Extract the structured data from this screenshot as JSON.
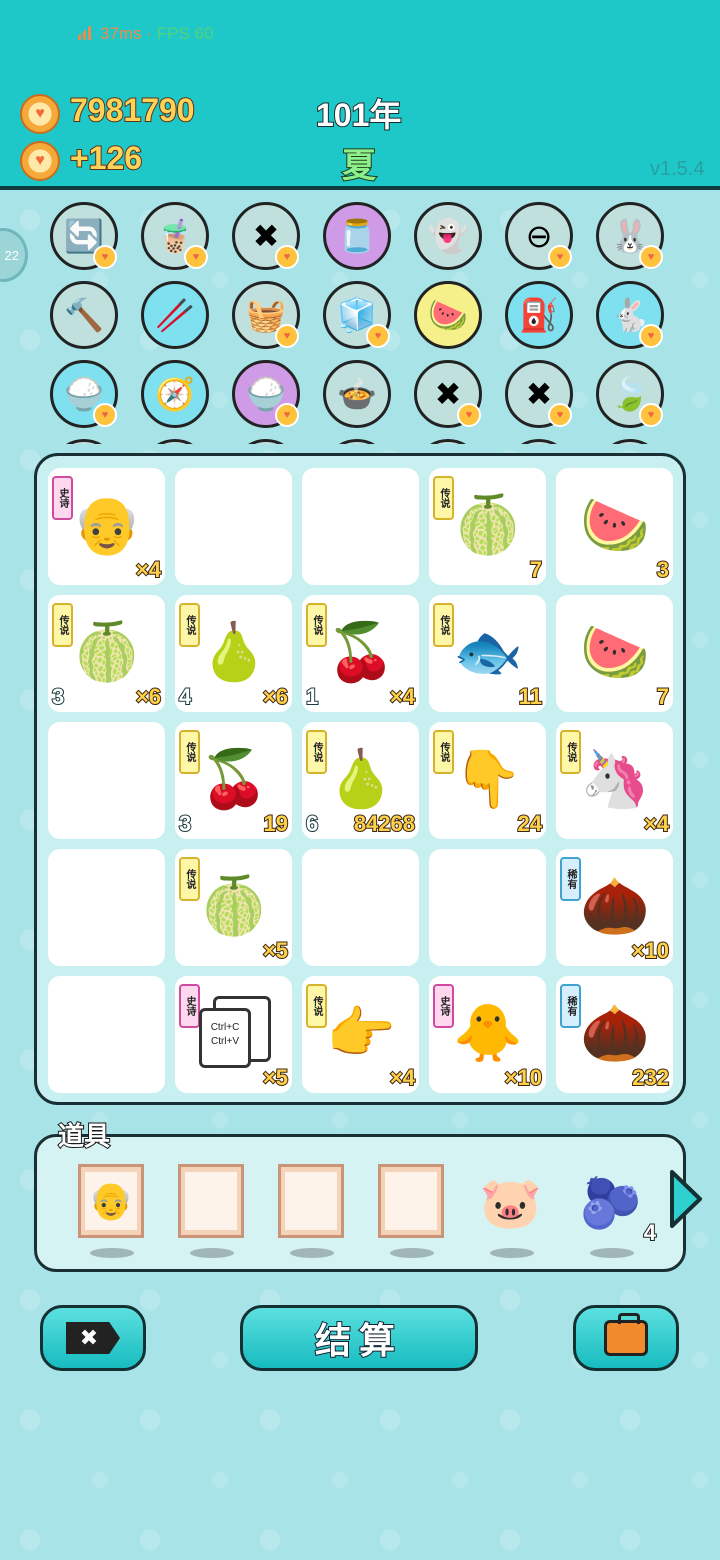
{
  "status": {
    "ping": "37ms",
    "sep": "·",
    "fps": "FPS 60"
  },
  "header": {
    "coins": "7981790",
    "income": "+126",
    "year": "101年",
    "season": "夏",
    "version": "v1.5.4"
  },
  "side_bubble": "22",
  "top_icons": [
    {
      "icon": "refresh-icon",
      "glyph": "🔄",
      "bg": "#bfe0dc",
      "badge": true
    },
    {
      "icon": "bubble-tea-icon",
      "glyph": "🧋",
      "bg": "#bfe0dc",
      "badge": true
    },
    {
      "icon": "delete-tag-icon",
      "glyph": "✖",
      "bg": "#bfe0dc",
      "badge": true
    },
    {
      "icon": "jar-icon",
      "glyph": "🫙",
      "bg": "#cf9be6",
      "badge": false
    },
    {
      "icon": "ghost-icon",
      "glyph": "👻",
      "bg": "#bfe0dc",
      "badge": false
    },
    {
      "icon": "no-entry-icon",
      "glyph": "⊖",
      "bg": "#bfe0dc",
      "badge": true
    },
    {
      "icon": "rabbit-icon",
      "glyph": "🐰",
      "bg": "#bfe0dc",
      "badge": true
    },
    {
      "icon": "hammer-icon",
      "glyph": "🔨",
      "bg": "#bfe0dc",
      "badge": false
    },
    {
      "icon": "chopsticks-icon",
      "glyph": "🥢",
      "bg": "#7fe0f0",
      "badge": false
    },
    {
      "icon": "fruit-basket-icon",
      "glyph": "🧺",
      "bg": "#bfe0dc",
      "badge": true
    },
    {
      "icon": "sugar-cubes-icon",
      "glyph": "🧊",
      "bg": "#bfe0dc",
      "badge": true
    },
    {
      "icon": "fruit-plate-icon",
      "glyph": "🍉",
      "bg": "#f6f08a",
      "badge": false
    },
    {
      "icon": "pump-icon",
      "glyph": "⛽",
      "bg": "#7fe0f0",
      "badge": false
    },
    {
      "icon": "rabbit-icon",
      "glyph": "🐇",
      "bg": "#7fe0f0",
      "badge": true
    },
    {
      "icon": "rice-bowl-icon",
      "glyph": "🍚",
      "bg": "#7fe0f0",
      "badge": true
    },
    {
      "icon": "compass-icon",
      "glyph": "🧭",
      "bg": "#7fe0f0",
      "badge": false
    },
    {
      "icon": "rice-bowl-icon",
      "glyph": "🍚",
      "bg": "#cf9be6",
      "badge": true
    },
    {
      "icon": "pot-icon",
      "glyph": "🍲",
      "bg": "#bfe0dc",
      "badge": false
    },
    {
      "icon": "delete-tag-icon",
      "glyph": "✖",
      "bg": "#bfe0dc",
      "badge": true
    },
    {
      "icon": "delete-tag-icon",
      "glyph": "✖",
      "bg": "#bfe0dc",
      "badge": true
    },
    {
      "icon": "leaf-icon",
      "glyph": "🍃",
      "bg": "#bfe0dc",
      "badge": true
    }
  ],
  "inventory": [
    {
      "tag": "史诗",
      "rarity": "epic",
      "icon": "farmer-icon",
      "glyph": "👴",
      "lvl": "",
      "qty": "×4"
    },
    {
      "tag": "",
      "rarity": "",
      "icon": "",
      "glyph": "",
      "lvl": "",
      "qty": ""
    },
    {
      "tag": "",
      "rarity": "",
      "icon": "",
      "glyph": "",
      "lvl": "",
      "qty": ""
    },
    {
      "tag": "传说",
      "rarity": "legend",
      "icon": "watermelon-icon",
      "glyph": "🍈",
      "lvl": "",
      "qty": "7"
    },
    {
      "tag": "",
      "rarity": "",
      "icon": "watermelon-slice-icon",
      "glyph": "🍉",
      "lvl": "",
      "qty": "3"
    },
    {
      "tag": "传说",
      "rarity": "legend",
      "icon": "watermelon-icon",
      "glyph": "🍈",
      "lvl": "3",
      "qty": "×6"
    },
    {
      "tag": "传说",
      "rarity": "legend",
      "icon": "pear-icon",
      "glyph": "🍐",
      "lvl": "4",
      "qty": "×6"
    },
    {
      "tag": "传说",
      "rarity": "legend",
      "icon": "longan-icon",
      "glyph": "🍒",
      "lvl": "1",
      "qty": "×4"
    },
    {
      "tag": "传说",
      "rarity": "legend",
      "icon": "koi-icon",
      "glyph": "🐟",
      "lvl": "",
      "qty": "11"
    },
    {
      "tag": "",
      "rarity": "",
      "icon": "watermelon-slice-icon",
      "glyph": "🍉",
      "lvl": "",
      "qty": "7"
    },
    {
      "tag": "",
      "rarity": "",
      "icon": "",
      "glyph": "",
      "lvl": "",
      "qty": ""
    },
    {
      "tag": "传说",
      "rarity": "legend",
      "icon": "longan-icon",
      "glyph": "🍒",
      "lvl": "3",
      "qty": "19"
    },
    {
      "tag": "传说",
      "rarity": "legend",
      "icon": "pear-icon",
      "glyph": "🍐",
      "lvl": "6",
      "qty": "84268"
    },
    {
      "tag": "传说",
      "rarity": "legend",
      "icon": "finger-icon",
      "glyph": "👇",
      "lvl": "",
      "qty": "24"
    },
    {
      "tag": "传说",
      "rarity": "legend",
      "icon": "unicorn-icon",
      "glyph": "🦄",
      "lvl": "",
      "qty": "×4"
    },
    {
      "tag": "",
      "rarity": "",
      "icon": "",
      "glyph": "",
      "lvl": "",
      "qty": ""
    },
    {
      "tag": "传说",
      "rarity": "legend",
      "icon": "watermelon-icon",
      "glyph": "🍈",
      "lvl": "",
      "qty": "×5"
    },
    {
      "tag": "",
      "rarity": "",
      "icon": "",
      "glyph": "",
      "lvl": "",
      "qty": ""
    },
    {
      "tag": "",
      "rarity": "",
      "icon": "",
      "glyph": "",
      "lvl": "",
      "qty": ""
    },
    {
      "tag": "稀有",
      "rarity": "rare",
      "icon": "nut-icon",
      "glyph": "🌰",
      "lvl": "",
      "qty": "×10"
    },
    {
      "tag": "",
      "rarity": "",
      "icon": "",
      "glyph": "",
      "lvl": "",
      "qty": ""
    },
    {
      "tag": "史诗",
      "rarity": "epic",
      "icon": "copy-paste-icon",
      "glyph": "📋",
      "lvl": "",
      "qty": "×5"
    },
    {
      "tag": "传说",
      "rarity": "legend",
      "icon": "pointing-hand-icon",
      "glyph": "👉",
      "lvl": "",
      "qty": "×4"
    },
    {
      "tag": "史诗",
      "rarity": "epic",
      "icon": "bird-icon",
      "glyph": "🐥",
      "lvl": "",
      "qty": "×10"
    },
    {
      "tag": "稀有",
      "rarity": "rare",
      "icon": "nut-icon",
      "glyph": "🌰",
      "lvl": "",
      "qty": "232"
    }
  ],
  "copy_paste": {
    "line1": "Ctrl+C",
    "line2": "Ctrl+V"
  },
  "tools": {
    "label": "道具",
    "slots": [
      {
        "icon": "portrait-frame-icon",
        "glyph": "👴",
        "count": ""
      },
      {
        "icon": "empty-frame-icon",
        "glyph": "",
        "count": ""
      },
      {
        "icon": "empty-frame-icon",
        "glyph": "",
        "count": ""
      },
      {
        "icon": "empty-frame-icon",
        "glyph": "",
        "count": ""
      },
      {
        "icon": "piggy-bank-icon",
        "glyph": "🐷",
        "count": ""
      },
      {
        "icon": "blueberry-icon",
        "glyph": "🫐",
        "count": "4"
      }
    ]
  },
  "buttons": {
    "settle": "结算"
  }
}
